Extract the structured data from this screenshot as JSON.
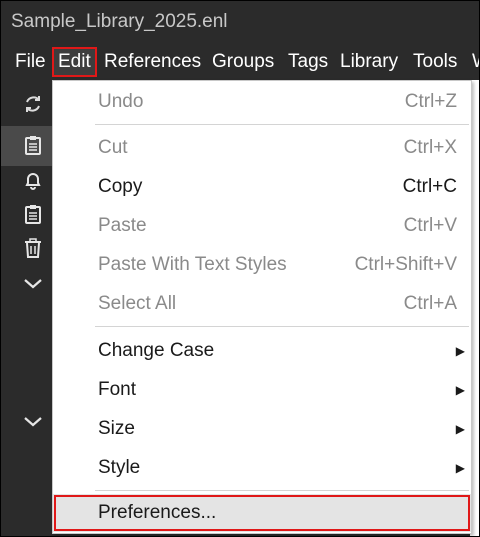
{
  "window": {
    "title": "Sample_Library_2025.enl"
  },
  "menubar": {
    "items": [
      "File",
      "Edit",
      "References",
      "Groups",
      "Tags",
      "Library",
      "Tools",
      "W"
    ]
  },
  "sidebar": {
    "icons": [
      "sync-icon",
      "clipboard-icon",
      "bell-icon",
      "clipboard-icon",
      "trash-icon",
      "chevron-down-icon",
      "chevron-down-icon"
    ]
  },
  "edit_menu": {
    "items": [
      {
        "label": "Undo",
        "shortcut": "Ctrl+Z",
        "enabled": false
      },
      {
        "label": "Cut",
        "shortcut": "Ctrl+X",
        "enabled": false
      },
      {
        "label": "Copy",
        "shortcut": "Ctrl+C",
        "enabled": true
      },
      {
        "label": "Paste",
        "shortcut": "Ctrl+V",
        "enabled": false
      },
      {
        "label": "Paste With Text Styles",
        "shortcut": "Ctrl+Shift+V",
        "enabled": false
      },
      {
        "label": "Select All",
        "shortcut": "Ctrl+A",
        "enabled": false
      },
      {
        "label": "Change Case",
        "submenu": true,
        "enabled": true
      },
      {
        "label": "Font",
        "submenu": true,
        "enabled": true
      },
      {
        "label": "Size",
        "submenu": true,
        "enabled": true
      },
      {
        "label": "Style",
        "submenu": true,
        "enabled": true
      },
      {
        "label": "Preferences...",
        "enabled": true,
        "highlighted": true
      }
    ]
  },
  "colors": {
    "highlight_border": "#e01818",
    "dark_background": "#2b2b2b"
  }
}
